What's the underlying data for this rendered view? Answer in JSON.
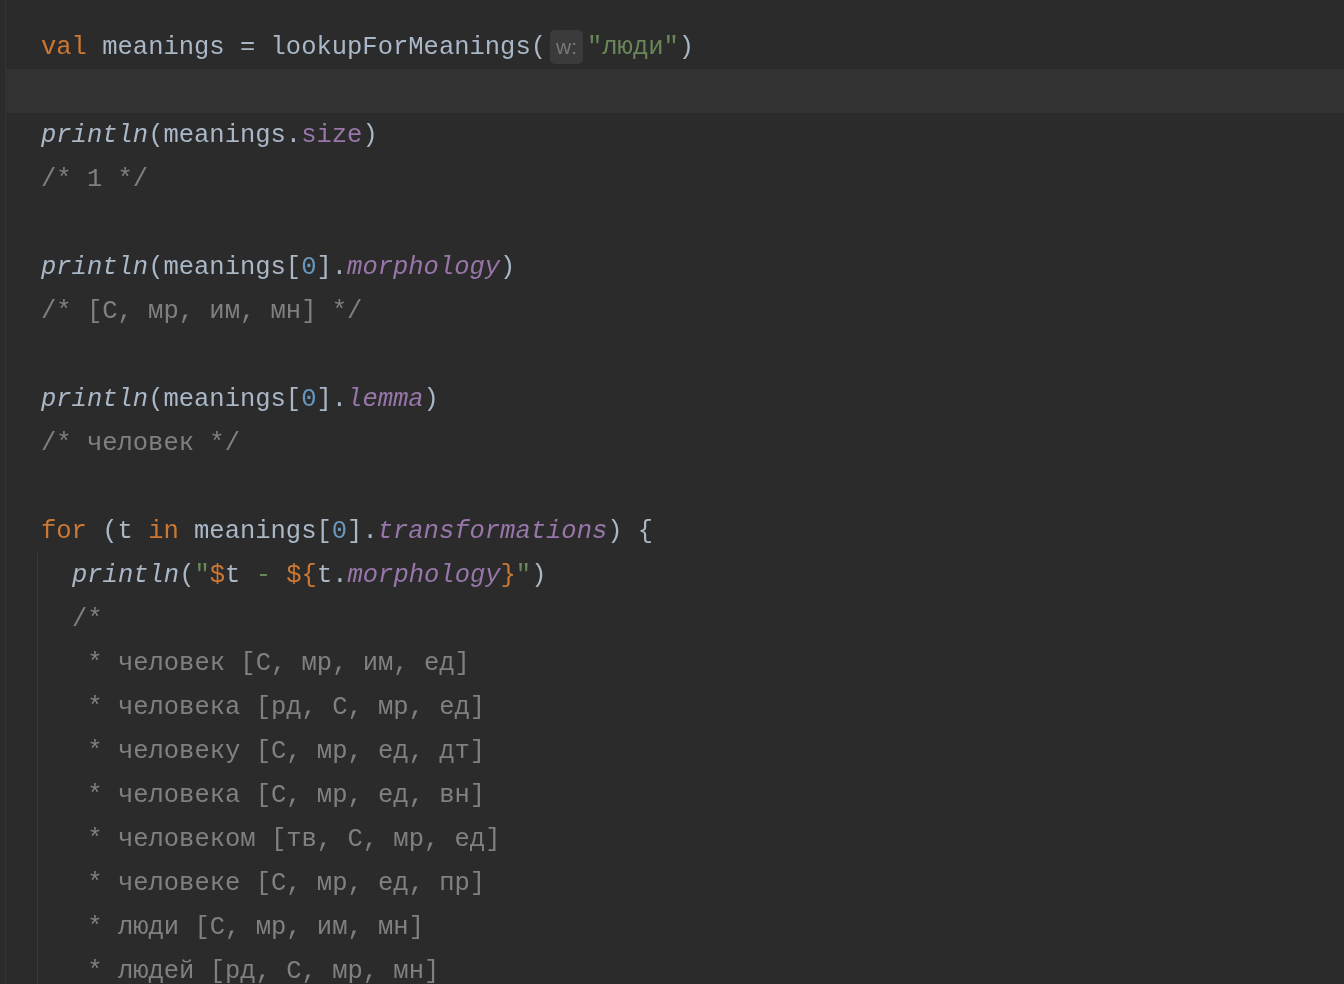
{
  "editor": {
    "lines": [
      {
        "kind": "code",
        "segments": [
          {
            "kind": "code",
            "tokens": [
              {
                "kind": "keyword",
                "text": "val"
              },
              {
                "kind": "plain",
                "text": " meanings = lookupForMeanings("
              }
            ]
          },
          {
            "kind": "hint",
            "text": "w:"
          },
          {
            "kind": "code",
            "tokens": [
              {
                "kind": "string",
                "text": "\"люди\""
              },
              {
                "kind": "plain",
                "text": ")"
              }
            ]
          }
        ]
      },
      {
        "kind": "caret"
      },
      {
        "kind": "code",
        "segments": [
          {
            "kind": "code",
            "tokens": [
              {
                "kind": "call",
                "text": "println"
              },
              {
                "kind": "plain",
                "text": "(meanings."
              },
              {
                "kind": "property",
                "text": "size"
              },
              {
                "kind": "plain",
                "text": ")"
              }
            ]
          }
        ]
      },
      {
        "kind": "code",
        "segments": [
          {
            "kind": "code",
            "tokens": [
              {
                "kind": "comment",
                "text": "/* 1 */"
              }
            ]
          }
        ]
      },
      {
        "kind": "blank"
      },
      {
        "kind": "code",
        "segments": [
          {
            "kind": "code",
            "tokens": [
              {
                "kind": "call",
                "text": "println"
              },
              {
                "kind": "plain",
                "text": "(meanings["
              },
              {
                "kind": "number",
                "text": "0"
              },
              {
                "kind": "plain",
                "text": "]."
              },
              {
                "kind": "extension",
                "text": "morphology"
              },
              {
                "kind": "plain",
                "text": ")"
              }
            ]
          }
        ]
      },
      {
        "kind": "code",
        "segments": [
          {
            "kind": "code",
            "tokens": [
              {
                "kind": "comment",
                "text": "/* [С, мр, им, мн] */"
              }
            ]
          }
        ]
      },
      {
        "kind": "blank"
      },
      {
        "kind": "code",
        "segments": [
          {
            "kind": "code",
            "tokens": [
              {
                "kind": "call",
                "text": "println"
              },
              {
                "kind": "plain",
                "text": "(meanings["
              },
              {
                "kind": "number",
                "text": "0"
              },
              {
                "kind": "plain",
                "text": "]."
              },
              {
                "kind": "extension",
                "text": "lemma"
              },
              {
                "kind": "plain",
                "text": ")"
              }
            ]
          }
        ]
      },
      {
        "kind": "code",
        "segments": [
          {
            "kind": "code",
            "tokens": [
              {
                "kind": "comment",
                "text": "/* человек */"
              }
            ]
          }
        ]
      },
      {
        "kind": "blank"
      },
      {
        "kind": "code",
        "segments": [
          {
            "kind": "code",
            "tokens": [
              {
                "kind": "keyword",
                "text": "for"
              },
              {
                "kind": "plain",
                "text": " (t "
              },
              {
                "kind": "keyword",
                "text": "in"
              },
              {
                "kind": "plain",
                "text": " meanings["
              },
              {
                "kind": "number",
                "text": "0"
              },
              {
                "kind": "plain",
                "text": "]."
              },
              {
                "kind": "extension",
                "text": "transformations"
              },
              {
                "kind": "plain",
                "text": ") {"
              }
            ]
          }
        ],
        "children": [
          {
            "kind": "code",
            "segments": [
              {
                "kind": "code",
                "tokens": [
                  {
                    "kind": "call",
                    "text": "println"
                  },
                  {
                    "kind": "plain",
                    "text": "("
                  },
                  {
                    "kind": "string",
                    "text": "\""
                  },
                  {
                    "kind": "template",
                    "text": "$"
                  },
                  {
                    "kind": "plain",
                    "text": "t"
                  },
                  {
                    "kind": "string",
                    "text": " - "
                  },
                  {
                    "kind": "template",
                    "text": "${"
                  },
                  {
                    "kind": "plain",
                    "text": "t."
                  },
                  {
                    "kind": "extension",
                    "text": "morphology"
                  },
                  {
                    "kind": "template",
                    "text": "}"
                  },
                  {
                    "kind": "string",
                    "text": "\""
                  },
                  {
                    "kind": "plain",
                    "text": ")"
                  }
                ]
              }
            ]
          },
          {
            "kind": "code",
            "segments": [
              {
                "kind": "code",
                "tokens": [
                  {
                    "kind": "comment",
                    "text": "/*"
                  }
                ]
              }
            ]
          },
          {
            "kind": "code",
            "segments": [
              {
                "kind": "code",
                "tokens": [
                  {
                    "kind": "comment",
                    "text": " * человек [С, мр, им, ед]"
                  }
                ]
              }
            ]
          },
          {
            "kind": "code",
            "segments": [
              {
                "kind": "code",
                "tokens": [
                  {
                    "kind": "comment",
                    "text": " * человека [рд, С, мр, ед]"
                  }
                ]
              }
            ]
          },
          {
            "kind": "code",
            "segments": [
              {
                "kind": "code",
                "tokens": [
                  {
                    "kind": "comment",
                    "text": " * человеку [С, мр, ед, дт]"
                  }
                ]
              }
            ]
          },
          {
            "kind": "code",
            "segments": [
              {
                "kind": "code",
                "tokens": [
                  {
                    "kind": "comment",
                    "text": " * человека [С, мр, ед, вн]"
                  }
                ]
              }
            ]
          },
          {
            "kind": "code",
            "segments": [
              {
                "kind": "code",
                "tokens": [
                  {
                    "kind": "comment",
                    "text": " * человеком [тв, С, мр, ед]"
                  }
                ]
              }
            ]
          },
          {
            "kind": "code",
            "segments": [
              {
                "kind": "code",
                "tokens": [
                  {
                    "kind": "comment",
                    "text": " * человеке [С, мр, ед, пр]"
                  }
                ]
              }
            ]
          },
          {
            "kind": "code",
            "segments": [
              {
                "kind": "code",
                "tokens": [
                  {
                    "kind": "comment",
                    "text": " * люди [С, мр, им, мн]"
                  }
                ]
              }
            ]
          },
          {
            "kind": "code",
            "segments": [
              {
                "kind": "code",
                "tokens": [
                  {
                    "kind": "comment",
                    "text": " * людей [рд, С, мр, мн]"
                  }
                ]
              }
            ]
          }
        ]
      }
    ]
  }
}
